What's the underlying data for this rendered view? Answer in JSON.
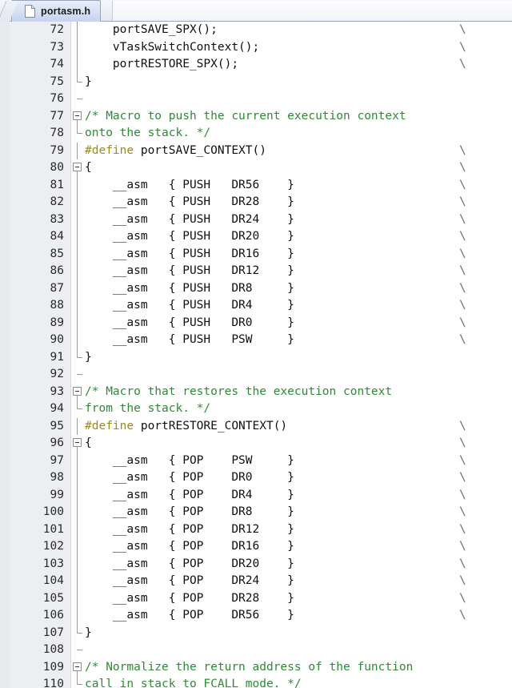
{
  "window": {
    "tab": {
      "label": "portasm.h",
      "icon": "document-icon"
    }
  },
  "editor": {
    "first_line": 72,
    "continuation_char": "\\",
    "colors": {
      "comment": "#2f8a36",
      "preprocessor": "#9a8b1e",
      "plain_text": "#101010",
      "gutter_background": "#eceef1",
      "editor_background": "#ffffff",
      "tab_active": "#d6e0f4"
    },
    "lines": [
      {
        "num": "72",
        "fold": "line",
        "cont": true,
        "spans": [
          {
            "t": "    portSAVE_SPX();",
            "c": "plain"
          }
        ]
      },
      {
        "num": "73",
        "fold": "line",
        "cont": true,
        "spans": [
          {
            "t": "    vTaskSwitchContext();",
            "c": "plain"
          }
        ]
      },
      {
        "num": "74",
        "fold": "line",
        "cont": true,
        "spans": [
          {
            "t": "    portRESTORE_SPX();",
            "c": "plain"
          }
        ]
      },
      {
        "num": "75",
        "fold": "end",
        "cont": false,
        "spans": [
          {
            "t": "}",
            "c": "plain"
          }
        ]
      },
      {
        "num": "76",
        "fold": "tick",
        "cont": false,
        "spans": [
          {
            "t": "",
            "c": "plain"
          }
        ]
      },
      {
        "num": "77",
        "fold": "box",
        "cont": false,
        "spans": [
          {
            "t": "/* Macro to push the current execution context",
            "c": "comment"
          }
        ]
      },
      {
        "num": "78",
        "fold": "end",
        "cont": false,
        "spans": [
          {
            "t": "onto the stack. */",
            "c": "comment"
          }
        ]
      },
      {
        "num": "79",
        "fold": "line",
        "cont": true,
        "spans": [
          {
            "t": "#define",
            "c": "pre"
          },
          {
            "t": " portSAVE_CONTEXT()",
            "c": "plain"
          }
        ]
      },
      {
        "num": "80",
        "fold": "box",
        "cont": true,
        "spans": [
          {
            "t": "{",
            "c": "plain"
          }
        ]
      },
      {
        "num": "81",
        "fold": "line",
        "cont": true,
        "spans": [
          {
            "t": "    __asm   { PUSH   DR56    }",
            "c": "plain"
          }
        ]
      },
      {
        "num": "82",
        "fold": "line",
        "cont": true,
        "spans": [
          {
            "t": "    __asm   { PUSH   DR28    }",
            "c": "plain"
          }
        ]
      },
      {
        "num": "83",
        "fold": "line",
        "cont": true,
        "spans": [
          {
            "t": "    __asm   { PUSH   DR24    }",
            "c": "plain"
          }
        ]
      },
      {
        "num": "84",
        "fold": "line",
        "cont": true,
        "spans": [
          {
            "t": "    __asm   { PUSH   DR20    }",
            "c": "plain"
          }
        ]
      },
      {
        "num": "85",
        "fold": "line",
        "cont": true,
        "spans": [
          {
            "t": "    __asm   { PUSH   DR16    }",
            "c": "plain"
          }
        ]
      },
      {
        "num": "86",
        "fold": "line",
        "cont": true,
        "spans": [
          {
            "t": "    __asm   { PUSH   DR12    }",
            "c": "plain"
          }
        ]
      },
      {
        "num": "87",
        "fold": "line",
        "cont": true,
        "spans": [
          {
            "t": "    __asm   { PUSH   DR8     }",
            "c": "plain"
          }
        ]
      },
      {
        "num": "88",
        "fold": "line",
        "cont": true,
        "spans": [
          {
            "t": "    __asm   { PUSH   DR4     }",
            "c": "plain"
          }
        ]
      },
      {
        "num": "89",
        "fold": "line",
        "cont": true,
        "spans": [
          {
            "t": "    __asm   { PUSH   DR0     }",
            "c": "plain"
          }
        ]
      },
      {
        "num": "90",
        "fold": "line",
        "cont": true,
        "spans": [
          {
            "t": "    __asm   { PUSH   PSW     }",
            "c": "plain"
          }
        ]
      },
      {
        "num": "91",
        "fold": "end",
        "cont": false,
        "spans": [
          {
            "t": "}",
            "c": "plain"
          }
        ]
      },
      {
        "num": "92",
        "fold": "tick",
        "cont": false,
        "spans": [
          {
            "t": "",
            "c": "plain"
          }
        ]
      },
      {
        "num": "93",
        "fold": "box",
        "cont": false,
        "spans": [
          {
            "t": "/* Macro that restores the execution context",
            "c": "comment"
          }
        ]
      },
      {
        "num": "94",
        "fold": "end",
        "cont": false,
        "spans": [
          {
            "t": "from the stack. */",
            "c": "comment"
          }
        ]
      },
      {
        "num": "95",
        "fold": "line",
        "cont": true,
        "spans": [
          {
            "t": "#define",
            "c": "pre"
          },
          {
            "t": " portRESTORE_CONTEXT()",
            "c": "plain"
          }
        ]
      },
      {
        "num": "96",
        "fold": "box",
        "cont": true,
        "spans": [
          {
            "t": "{",
            "c": "plain"
          }
        ]
      },
      {
        "num": "97",
        "fold": "line",
        "cont": true,
        "spans": [
          {
            "t": "    __asm   { POP    PSW     }",
            "c": "plain"
          }
        ]
      },
      {
        "num": "98",
        "fold": "line",
        "cont": true,
        "spans": [
          {
            "t": "    __asm   { POP    DR0     }",
            "c": "plain"
          }
        ]
      },
      {
        "num": "99",
        "fold": "line",
        "cont": true,
        "spans": [
          {
            "t": "    __asm   { POP    DR4     }",
            "c": "plain"
          }
        ]
      },
      {
        "num": "100",
        "fold": "line",
        "cont": true,
        "spans": [
          {
            "t": "    __asm   { POP    DR8     }",
            "c": "plain"
          }
        ]
      },
      {
        "num": "101",
        "fold": "line",
        "cont": true,
        "spans": [
          {
            "t": "    __asm   { POP    DR12    }",
            "c": "plain"
          }
        ]
      },
      {
        "num": "102",
        "fold": "line",
        "cont": true,
        "spans": [
          {
            "t": "    __asm   { POP    DR16    }",
            "c": "plain"
          }
        ]
      },
      {
        "num": "103",
        "fold": "line",
        "cont": true,
        "spans": [
          {
            "t": "    __asm   { POP    DR20    }",
            "c": "plain"
          }
        ]
      },
      {
        "num": "104",
        "fold": "line",
        "cont": true,
        "spans": [
          {
            "t": "    __asm   { POP    DR24    }",
            "c": "plain"
          }
        ]
      },
      {
        "num": "105",
        "fold": "line",
        "cont": true,
        "spans": [
          {
            "t": "    __asm   { POP    DR28    }",
            "c": "plain"
          }
        ]
      },
      {
        "num": "106",
        "fold": "line",
        "cont": true,
        "spans": [
          {
            "t": "    __asm   { POP    DR56    }",
            "c": "plain"
          }
        ]
      },
      {
        "num": "107",
        "fold": "end",
        "cont": false,
        "spans": [
          {
            "t": "}",
            "c": "plain"
          }
        ]
      },
      {
        "num": "108",
        "fold": "tick",
        "cont": false,
        "spans": [
          {
            "t": "",
            "c": "plain"
          }
        ]
      },
      {
        "num": "109",
        "fold": "box",
        "cont": false,
        "spans": [
          {
            "t": "/* Normalize the return address of the function",
            "c": "comment"
          }
        ]
      },
      {
        "num": "110",
        "fold": "end",
        "cont": false,
        "spans": [
          {
            "t": "call in stack to FCALL mode. */",
            "c": "comment"
          }
        ]
      }
    ]
  }
}
